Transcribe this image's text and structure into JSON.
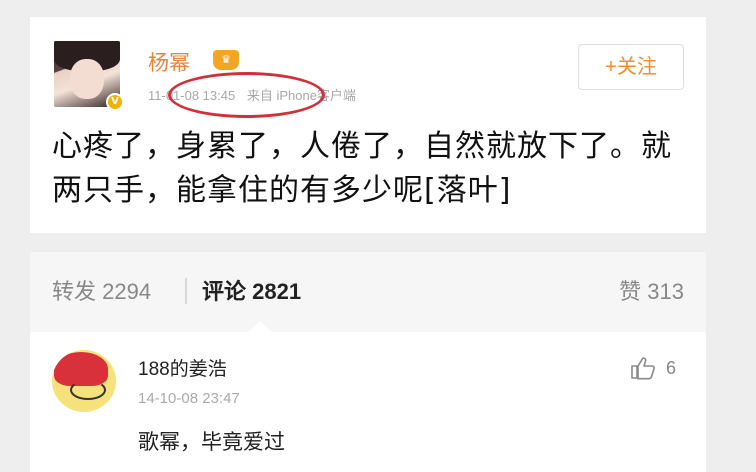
{
  "post": {
    "username": "杨幂",
    "badge_icon": "crown-icon",
    "timestamp": "11-01-08 13:45",
    "source": "来自 iPhone客户端",
    "follow_label": "+关注",
    "text": "心疼了，身累了，人倦了，自然就放下了。就两只手，能拿住的有多少呢[落叶]"
  },
  "stats": {
    "repost": "转发 2294",
    "comment": "评论 2821",
    "like": "赞 313"
  },
  "comment": {
    "name": "188的姜浩",
    "time": "14-10-08 23:47",
    "text": "歌幂，毕竟爱过",
    "likes": "6"
  },
  "colors": {
    "accent": "#f28c2c",
    "highlight_oval": "#d1303a",
    "username": "#e8833a"
  }
}
